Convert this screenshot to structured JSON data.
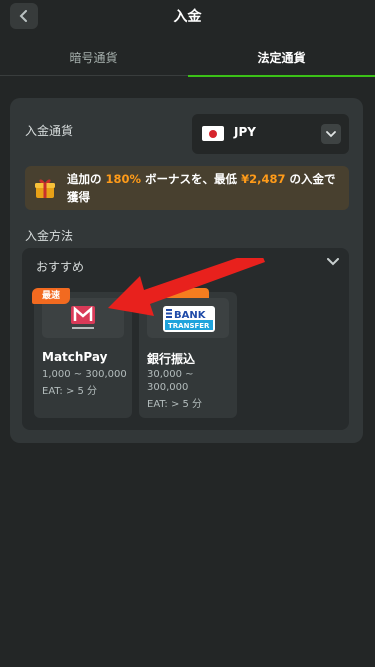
{
  "header": {
    "title": "入金"
  },
  "tabs": [
    {
      "label": "暗号通貨",
      "active": false
    },
    {
      "label": "法定通貨",
      "active": true
    }
  ],
  "deposit": {
    "currency_label": "入金通貨",
    "currency_value": "JPY",
    "bonus": {
      "prefix": "追加の",
      "percent": "180%",
      "middle": "ボーナスを、最低",
      "amount": "¥2,487",
      "suffix": "の入金で獲得"
    },
    "method_label": "入金方法",
    "recommended_label": "おすすめ",
    "methods": [
      {
        "badge": "最速",
        "name": "MatchPay",
        "range": "1,000 ~ 300,000",
        "eat": "EAT: > 5 分",
        "logo_text": "MATCH PAY"
      },
      {
        "badge": "",
        "name": "銀行振込",
        "range": "30,000 ~ 300,000",
        "eat": "EAT: > 5 分",
        "logo_text_top": "BANK",
        "logo_text_bottom": "TRANSFER"
      }
    ]
  },
  "colors": {
    "background": "#232626",
    "panel": "#323738",
    "accent_green": "#3bc117",
    "highlight_orange": "#ff9b19",
    "arrow_red": "#e8211d"
  }
}
